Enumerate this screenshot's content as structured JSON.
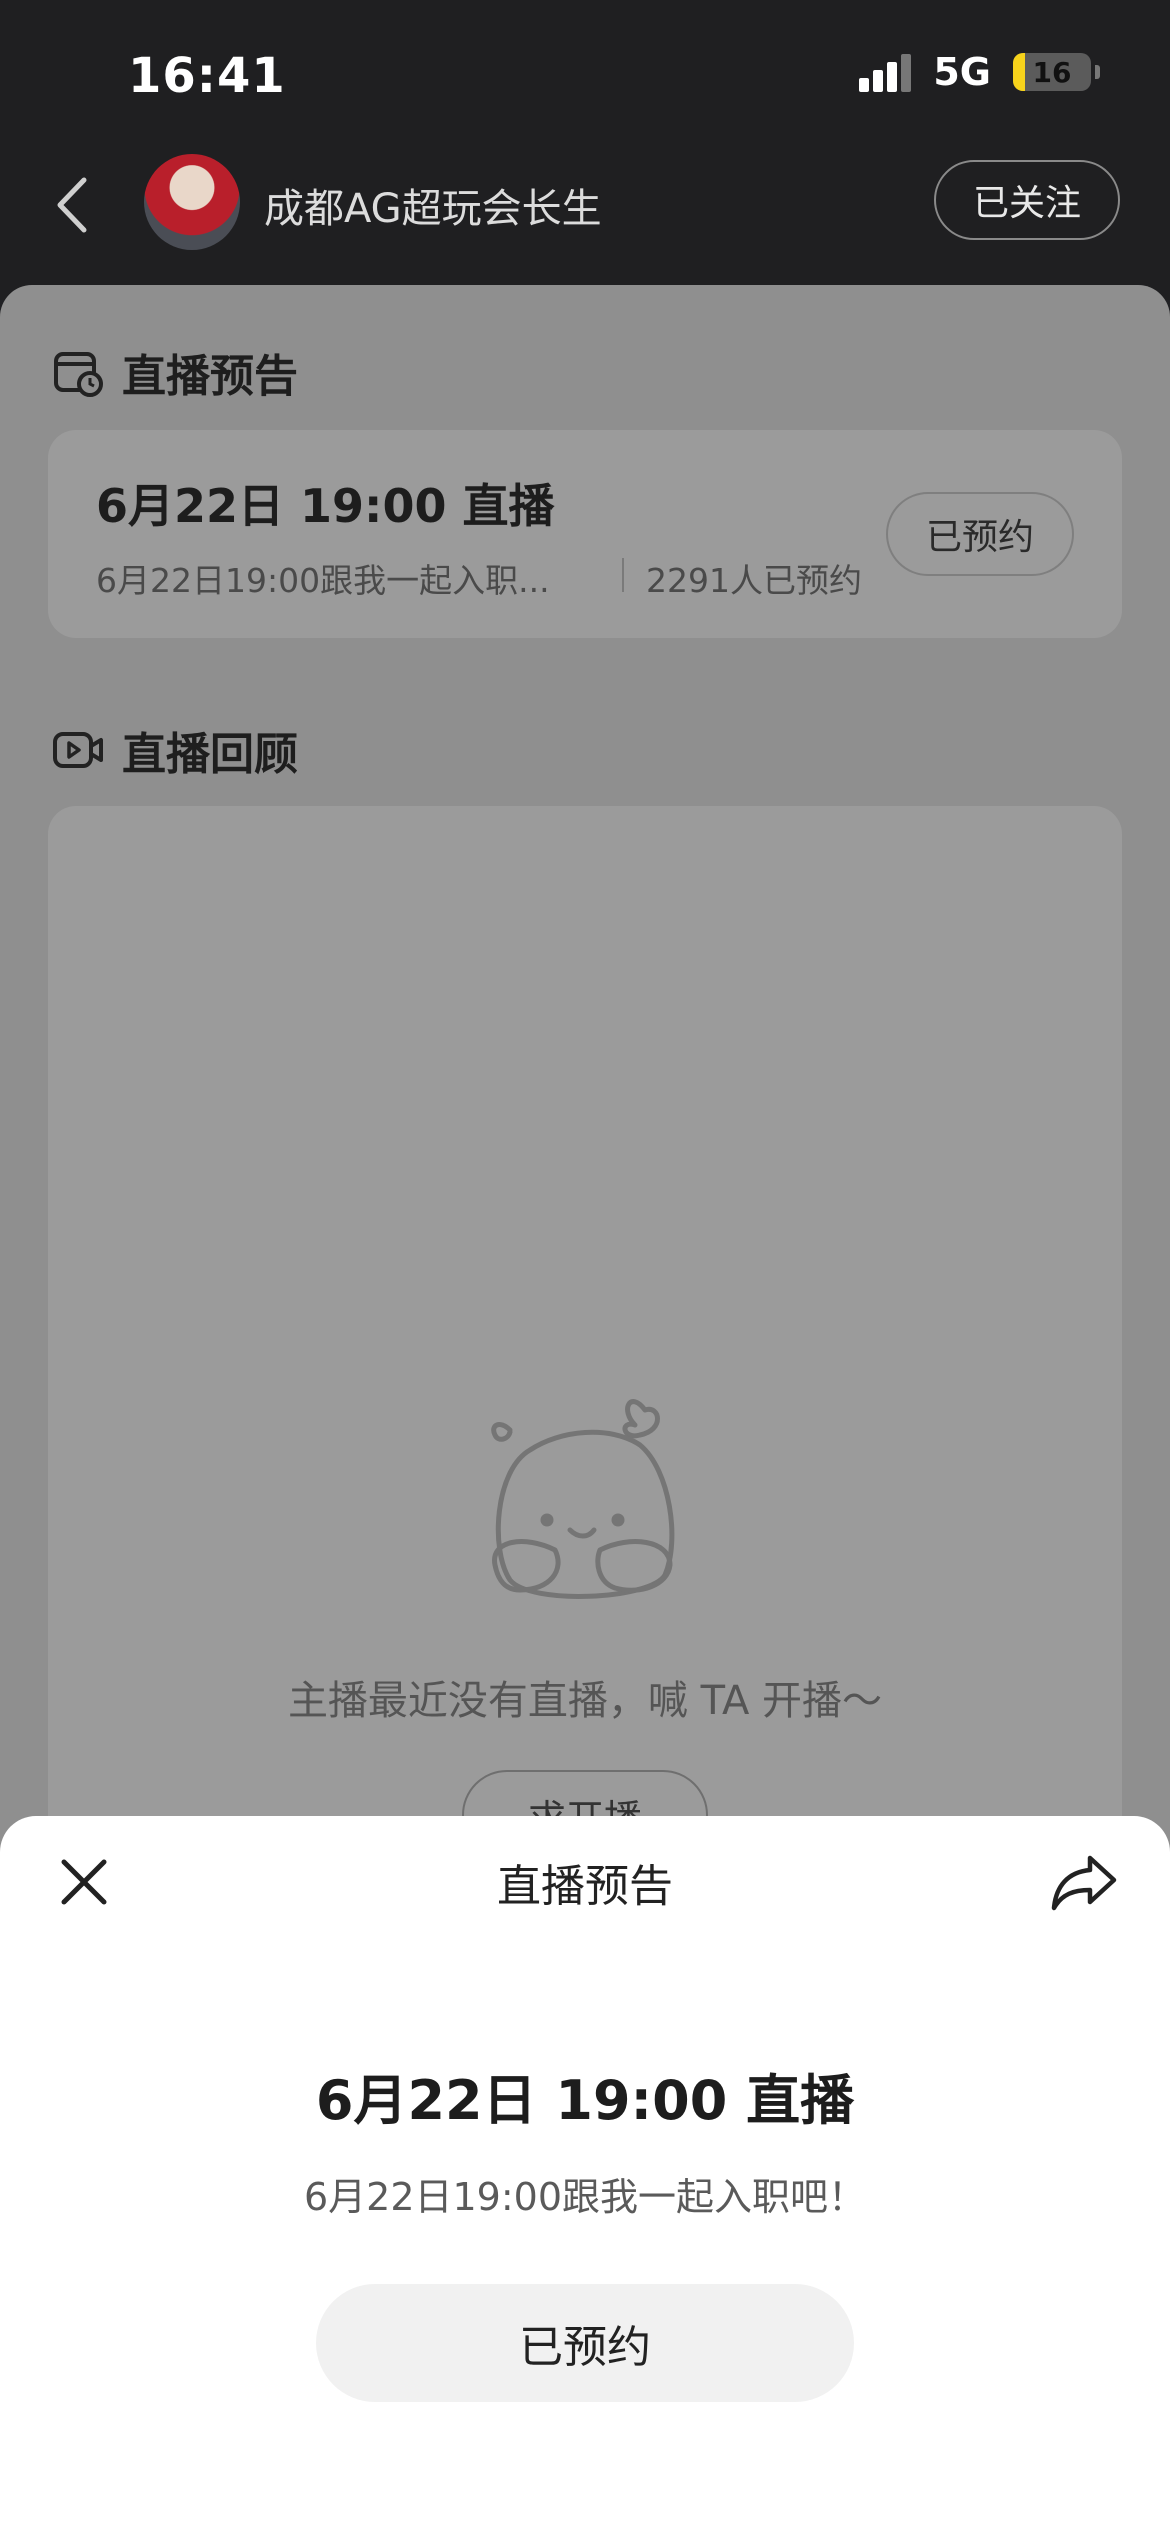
{
  "status_bar": {
    "time": "16:41",
    "network": "5G",
    "battery": "16",
    "battery_level": 0.16
  },
  "header": {
    "username": "成都AG超玩会长生",
    "follow_label": "已关注"
  },
  "preview_section": {
    "title": "直播预告",
    "card": {
      "title": "6月22日 19:00 直播",
      "subtitle": "6月22日19:00跟我一起入职...",
      "count": "2291人已预约",
      "reserve_label": "已预约"
    }
  },
  "replay_section": {
    "title": "直播回顾",
    "empty_text": "主播最近没有直播，喊 TA 开播～",
    "request_button": "求开播"
  },
  "modal": {
    "title": "直播预告",
    "event_title": "6月22日 19:00 直播",
    "event_subtitle": "6月22日19:00跟我一起入职吧！",
    "reserved_label": "已预约"
  }
}
